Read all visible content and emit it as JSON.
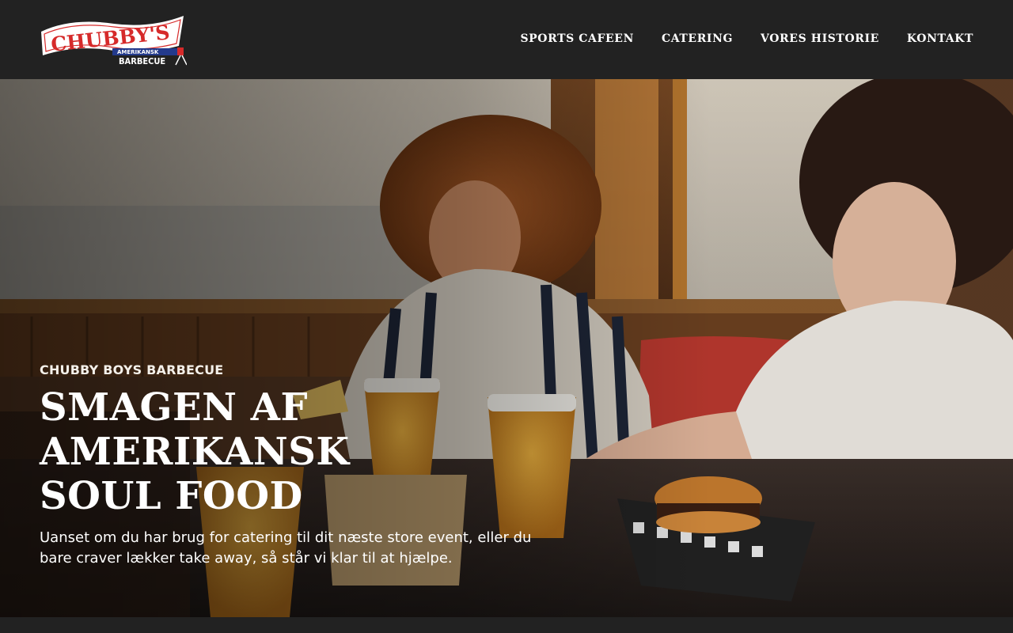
{
  "brand": {
    "logo_main": "CHUBBY'S",
    "logo_tag": "AMERIKANSK",
    "logo_sub": "BARBECUE"
  },
  "nav": {
    "items": [
      {
        "label": "SPORTS CAFEEN"
      },
      {
        "label": "CATERING"
      },
      {
        "label": "VORES HISTORIE"
      },
      {
        "label": "KONTAKT"
      }
    ]
  },
  "hero": {
    "eyebrow": "CHUBBY BOYS BARBECUE",
    "headline": "SMAGEN AF AMERIKANSK SOUL FOOD",
    "lead": "Uanset om du har brug for catering til dit næste store event, eller du bare craver lækker take away, så står vi klar til at hjælpe."
  },
  "colors": {
    "header_bg": "#222222",
    "logo_red": "#d62a2a",
    "logo_blue": "#233a8c",
    "text": "#ffffff"
  }
}
